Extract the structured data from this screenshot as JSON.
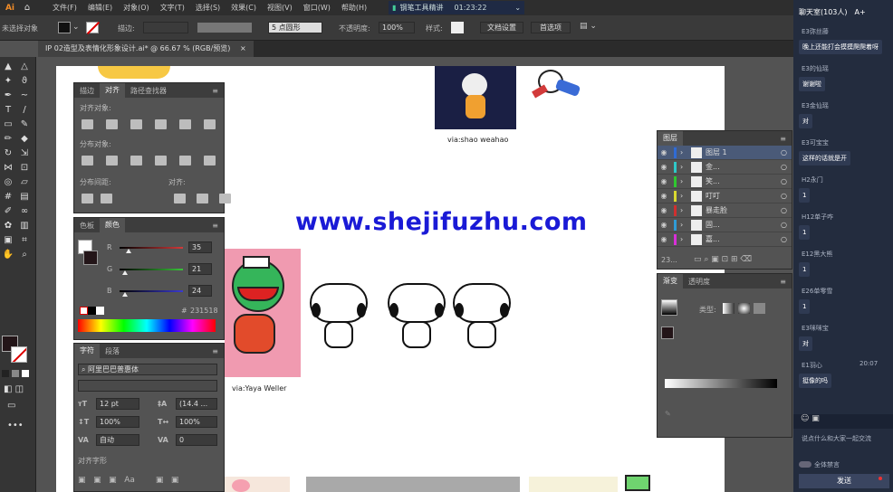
{
  "app": {
    "logo": "Ai"
  },
  "menu": [
    "文件(F)",
    "编辑(E)",
    "对象(O)",
    "文字(T)",
    "选择(S)",
    "效果(C)",
    "视图(V)",
    "窗口(W)",
    "帮助(H)"
  ],
  "search": {
    "text": "钢笔工具精讲",
    "time": "01:23:22"
  },
  "control": {
    "left_label": "未选择对象",
    "stroke_label": "描边:",
    "stroke_value": "5 点圆形",
    "opacity_label": "不透明度:",
    "opacity_value": "100%",
    "style_label": "样式:",
    "doc_settings": "文档设置",
    "prefs": "首选项"
  },
  "doc_tab": {
    "title": "IP 02造型及表情化形象设计.ai* @ 66.67 % (RGB/预览)",
    "close": "×"
  },
  "align_panel": {
    "tabs": [
      "描边",
      "对齐",
      "路径查找器"
    ],
    "s1": "对齐对象:",
    "s2": "分布对象:",
    "s3": "分布间距:",
    "s4": "对齐:"
  },
  "color_panel": {
    "tabs": [
      "色板",
      "颜色"
    ],
    "rows": [
      {
        "label": "R",
        "value": "35",
        "color": "#d23a3a",
        "pos": 0.14
      },
      {
        "label": "G",
        "value": "21",
        "color": "#3ac23a",
        "pos": 0.08
      },
      {
        "label": "B",
        "value": "24",
        "color": "#3a3ad2",
        "pos": 0.09
      }
    ],
    "hex_label": "#",
    "hex": "231518"
  },
  "char_panel": {
    "tabs": [
      "字符",
      "段落"
    ],
    "font": "阿里巴巴普惠体",
    "size": "12 pt",
    "lead": "(14.4 ...",
    "vs": "100%",
    "hs": "100%",
    "kern": "自动",
    "track": "0",
    "opentype": "对齐字形"
  },
  "layers": {
    "title": "图层",
    "rows": [
      {
        "name": "图层 1",
        "color": "#2f6bd6"
      },
      {
        "name": "金...",
        "color": "#2fc8c8"
      },
      {
        "name": "笑...",
        "color": "#2fc82f"
      },
      {
        "name": "叮叮",
        "color": "#d8d830"
      },
      {
        "name": "暴走脸",
        "color": "#d02f2f"
      },
      {
        "name": "固...",
        "color": "#2f9bd6"
      },
      {
        "name": "嘉...",
        "color": "#d82fd8"
      }
    ],
    "count": "23..."
  },
  "gradient": {
    "tabs": [
      "渐变",
      "透明度"
    ],
    "type_label": "类型:"
  },
  "captions": {
    "top": "via:shao weahao",
    "left": "via:Yaya Weller"
  },
  "watermark": "www.shejifuzhu.com",
  "chat": {
    "header": "聊天室(103人)",
    "font": "A+",
    "items": [
      {
        "name": "E3弥丝藤",
        "msg": "晚上还能打会摸摸爬爬着呀"
      },
      {
        "name": "E3的仙瑶",
        "msg": "谢谢啦"
      },
      {
        "name": "E3金仙瑶",
        "msg": "对"
      },
      {
        "name": "E3可宝宝",
        "msg": "这样的话就是开"
      },
      {
        "name": "H2永门",
        "msg": "1"
      },
      {
        "name": "H12单子咋",
        "msg": "1"
      },
      {
        "name": "E12黑大熊",
        "msg": "1"
      },
      {
        "name": "E26单零雪",
        "msg": "1"
      },
      {
        "name": "E3咪咪宝",
        "msg": "对"
      },
      {
        "name": "E1羽心",
        "msg": "挺像的吗"
      }
    ],
    "time": "20:07",
    "input_hint": "说点什么和大家一起交流",
    "toggle": "全体禁言",
    "send": "发送"
  }
}
